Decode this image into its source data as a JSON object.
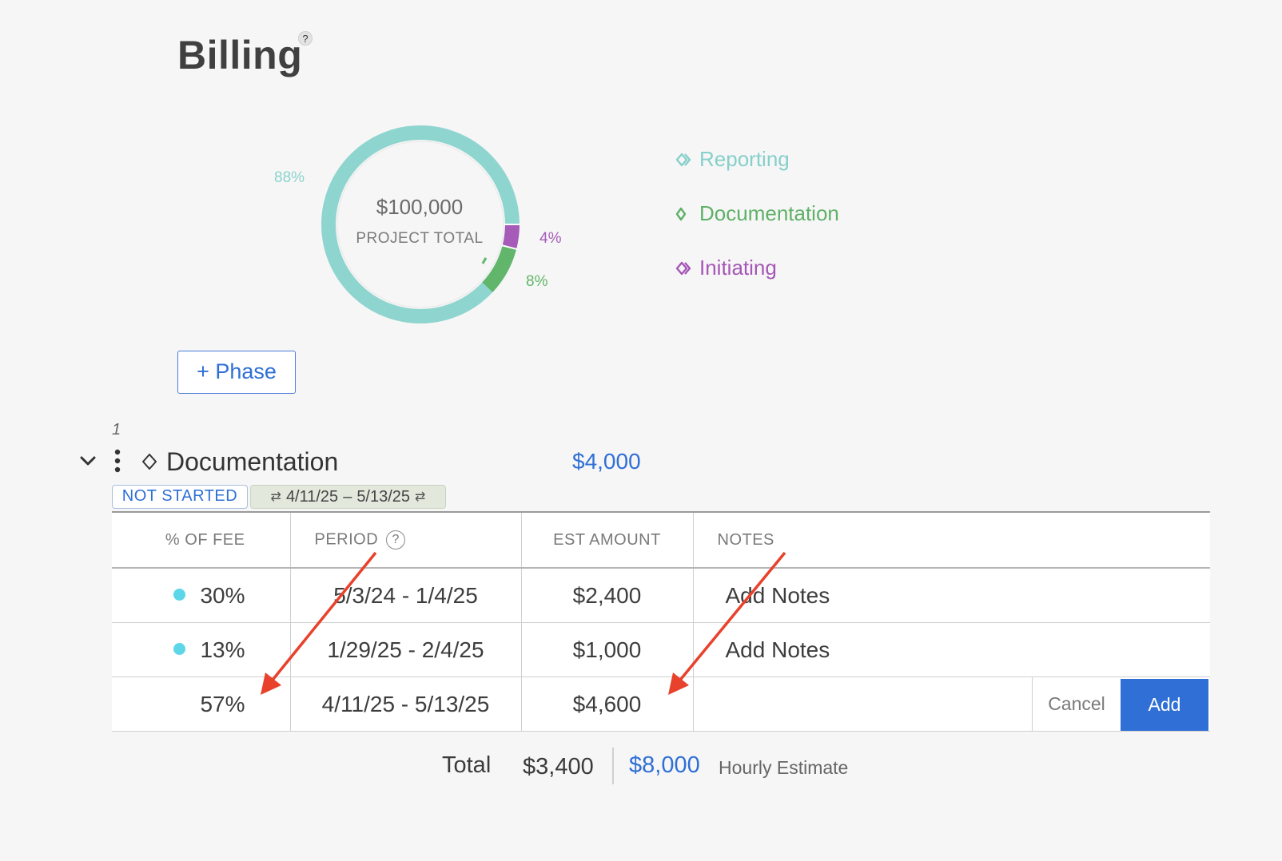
{
  "header": {
    "title": "Billing",
    "help_label": "?"
  },
  "donut": {
    "center_amount": "$100,000",
    "center_label": "PROJECT TOTAL",
    "segments": [
      {
        "name": "Reporting",
        "percent_label": "88%",
        "fraction": 0.88,
        "color": "#8fd5cf"
      },
      {
        "name": "Initiating",
        "percent_label": "4%",
        "fraction": 0.04,
        "color": "#a65bb9"
      },
      {
        "name": "Documentation",
        "percent_label": "8%",
        "fraction": 0.08,
        "color": "#62b66b"
      }
    ]
  },
  "legend": [
    {
      "label": "Reporting",
      "color": "#86d0cb"
    },
    {
      "label": "Documentation",
      "color": "#5fb068"
    },
    {
      "label": "Initiating",
      "color": "#a556b6"
    }
  ],
  "add_phase_label": "+ Phase",
  "phase": {
    "number": "1",
    "name": "Documentation",
    "amount": "$4,000",
    "status": "NOT STARTED",
    "start_date": "4/11/25",
    "end_date": "5/13/25",
    "date_separator": "–",
    "date_icon": "⇄"
  },
  "table": {
    "headers": {
      "fee": "% OF FEE",
      "period": "PERIOD",
      "amount": "EST AMOUNT",
      "notes": "NOTES",
      "period_help": "?"
    },
    "rows": [
      {
        "fee": "30%",
        "period": "5/3/24 - 1/4/25",
        "amount": "$2,400",
        "notes_placeholder": "Add Notes"
      },
      {
        "fee": "13%",
        "period": "1/29/25 - 2/4/25",
        "amount": "$1,000",
        "notes_placeholder": "Add Notes"
      }
    ],
    "edit_row": {
      "fee": "57%",
      "period": "4/11/25 - 5/13/25",
      "amount": "$4,600"
    },
    "cancel_label": "Cancel",
    "add_label": "Add"
  },
  "totals": {
    "total_label": "Total",
    "total_value": "$3,400",
    "hourly_value": "$8,000",
    "hourly_label": "Hourly Estimate"
  },
  "colors": {
    "accent": "#2f6fd6",
    "annotation": "#e8412c",
    "dot": "#5dd6e8"
  }
}
